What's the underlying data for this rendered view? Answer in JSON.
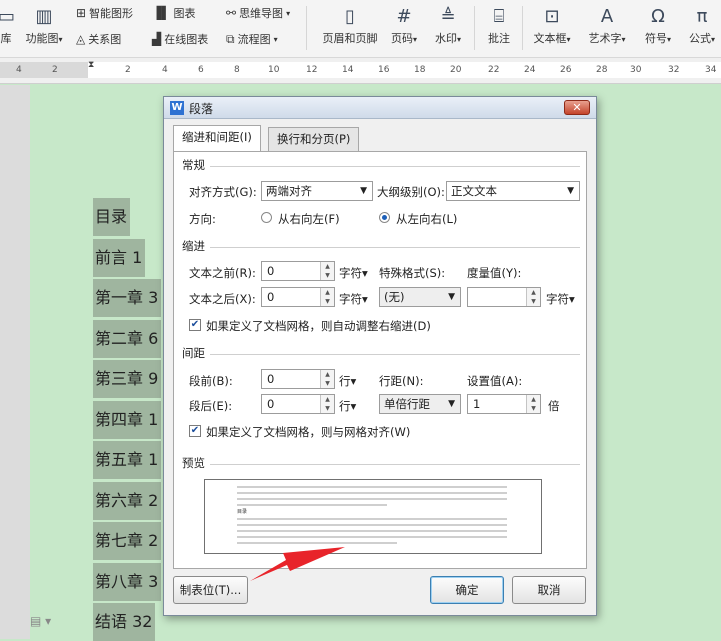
{
  "ribbon": {
    "small_left": [
      {
        "label": "智能图形",
        "icon": "smart-shape-icon"
      },
      {
        "label": "图表",
        "icon": "chart-icon"
      },
      {
        "label": "思维导图",
        "icon": "mindmap-icon"
      },
      {
        "label": "关系图",
        "icon": "relation-icon"
      },
      {
        "label": "在线图表",
        "icon": "online-chart-icon"
      },
      {
        "label": "流程图",
        "icon": "flowchart-icon"
      }
    ],
    "big_left": [
      {
        "label": "库",
        "icon": "library-icon"
      },
      {
        "label": "功能图",
        "icon": "function-chart-icon"
      }
    ],
    "big_right": [
      {
        "label": "页眉和页脚",
        "icon": "header-footer-icon"
      },
      {
        "label": "页码",
        "icon": "page-number-icon"
      },
      {
        "label": "水印",
        "icon": "watermark-icon"
      },
      {
        "label": "批注",
        "icon": "comment-icon"
      },
      {
        "label": "文本框",
        "icon": "textbox-icon"
      },
      {
        "label": "艺术字",
        "icon": "wordart-icon"
      },
      {
        "label": "符号",
        "icon": "symbol-icon"
      },
      {
        "label": "公式",
        "icon": "formula-icon"
      }
    ]
  },
  "ruler": {
    "numbers": [
      "4",
      "2",
      "2",
      "4",
      "6",
      "8",
      "10",
      "12",
      "14",
      "16",
      "18",
      "20",
      "22",
      "24",
      "26",
      "28",
      "30",
      "32",
      "34"
    ]
  },
  "document": {
    "toc": [
      "目录",
      "前言 1",
      "第一章 3",
      "第二章 6",
      "第三章 9",
      "第四章 1",
      "第五章 1",
      "第六章 2",
      "第七章 2",
      "第八章 3",
      "结语 32"
    ]
  },
  "dialog": {
    "title": "段落",
    "app_icon": "W",
    "close": "✕",
    "tabs": [
      "缩进和间距(I)",
      "换行和分页(P)"
    ],
    "general": {
      "heading": "常规",
      "align_label": "对齐方式(G):",
      "align_value": "两端对齐",
      "outline_label": "大纲级别(O):",
      "outline_value": "正文文本",
      "direction_label": "方向:",
      "dir_rtl": "从右向左(F)",
      "dir_ltr": "从左向右(L)"
    },
    "indent": {
      "heading": "缩进",
      "before_label": "文本之前(R):",
      "before_value": "0",
      "before_unit": "字符▾",
      "after_label": "文本之后(X):",
      "after_value": "0",
      "after_unit": "字符▾",
      "special_label": "特殊格式(S):",
      "special_value": "(无)",
      "measure_label": "度量值(Y):",
      "measure_value": "",
      "measure_unit": "字符▾",
      "auto_adjust": "如果定义了文档网格，则自动调整右缩进(D)"
    },
    "spacing": {
      "heading": "间距",
      "before_label": "段前(B):",
      "before_value": "0",
      "before_unit": "行▾",
      "after_label": "段后(E):",
      "after_value": "0",
      "after_unit": "行▾",
      "line_label": "行距(N):",
      "line_value": "单倍行距",
      "setting_label": "设置值(A):",
      "setting_value": "1",
      "setting_unit": "倍",
      "snap_grid": "如果定义了文档网格，则与网格对齐(W)"
    },
    "preview": {
      "heading": "预览",
      "sample": "目录"
    },
    "buttons": {
      "tabs": "制表位(T)...",
      "ok": "确定",
      "cancel": "取消"
    }
  },
  "colors": {
    "page_bg": "#c7e8c9",
    "toc_highlight": "#9fb59f",
    "arrow": "#e8242a",
    "accent": "#2e72d2"
  }
}
